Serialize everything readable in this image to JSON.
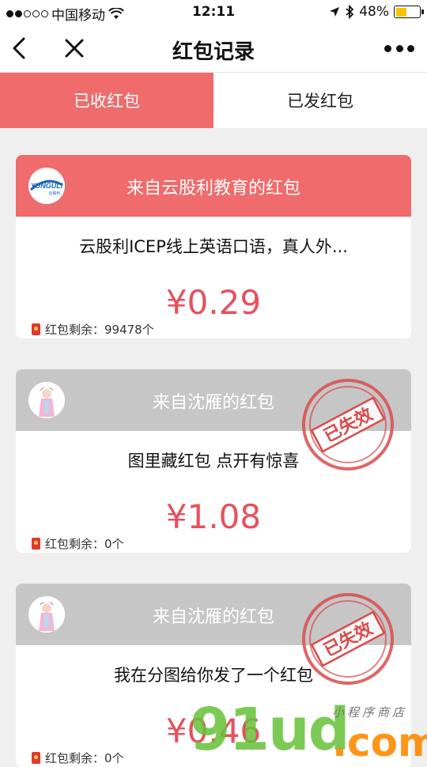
{
  "status_bar": {
    "carrier": "中国移动",
    "time": "12:11",
    "battery": "48%",
    "battery_level": 0.48
  },
  "nav": {
    "title": "红包记录",
    "back_icon": "chevron-left-icon",
    "close_icon": "close-icon",
    "more_icon": "more-dots-icon"
  },
  "tabs": [
    {
      "label": "已收红包",
      "active": true
    },
    {
      "label": "已发红包",
      "active": false
    }
  ],
  "cards": [
    {
      "from": "来自云股利教育的红包",
      "avatar_text": "YUNGULI",
      "avatar_sub": "云股利",
      "message": "云股利ICEP线上英语口语，真人外...",
      "amount": "¥0.29",
      "remaining": "红包剩余：99478个",
      "status": "active",
      "stamp": ""
    },
    {
      "from": "来自沈雁的红包",
      "message": "图里藏红包 点开有惊喜",
      "amount": "¥1.08",
      "remaining": "红包剩余：0个",
      "status": "expired",
      "stamp": "已失效"
    },
    {
      "from": "来自沈雁的红包",
      "message": "我在分图给你发了一个红包",
      "amount": "¥0.46",
      "remaining": "红包剩余：0个",
      "status": "expired",
      "stamp": "已失效"
    }
  ],
  "watermark": {
    "letters": "91ud",
    "domain": ".com",
    "tagline": "小程序商店"
  },
  "colors": {
    "accent": "#f06b6b",
    "amount": "#e5515e",
    "expired_header": "#c6c6c6",
    "stamp": "#d94b4b"
  }
}
